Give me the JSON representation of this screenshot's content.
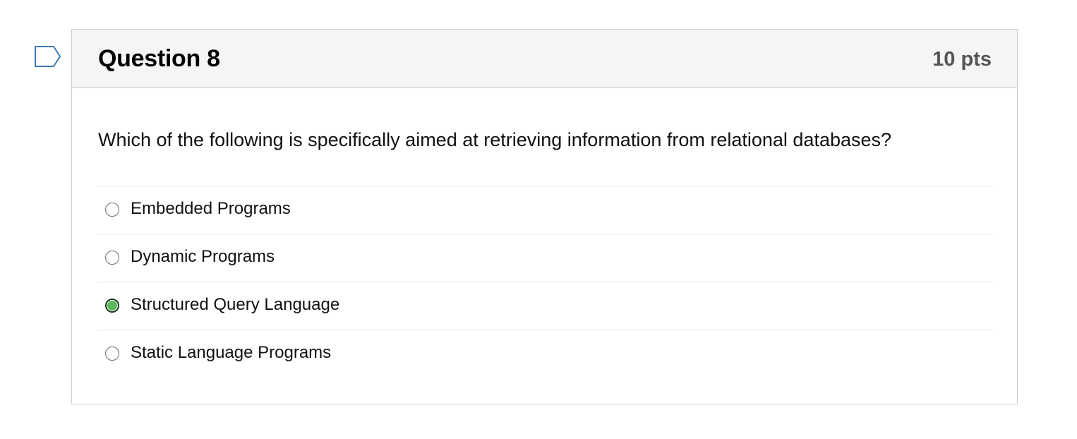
{
  "question": {
    "flag_icon": "bookmark-flag-icon",
    "title": "Question 8",
    "points": "10 pts",
    "text": "Which of the following is specifically aimed at retrieving information from relational databases?",
    "answers": [
      {
        "label": "Embedded Programs",
        "selected": false
      },
      {
        "label": "Dynamic Programs",
        "selected": false
      },
      {
        "label": "Structured Query Language",
        "selected": true
      },
      {
        "label": "Static Language Programs",
        "selected": false
      }
    ]
  },
  "colors": {
    "header_bg": "#f5f5f5",
    "border": "#c7cdd1",
    "flag_stroke": "#3d7ab3",
    "selected_fill": "#5cb85c"
  }
}
